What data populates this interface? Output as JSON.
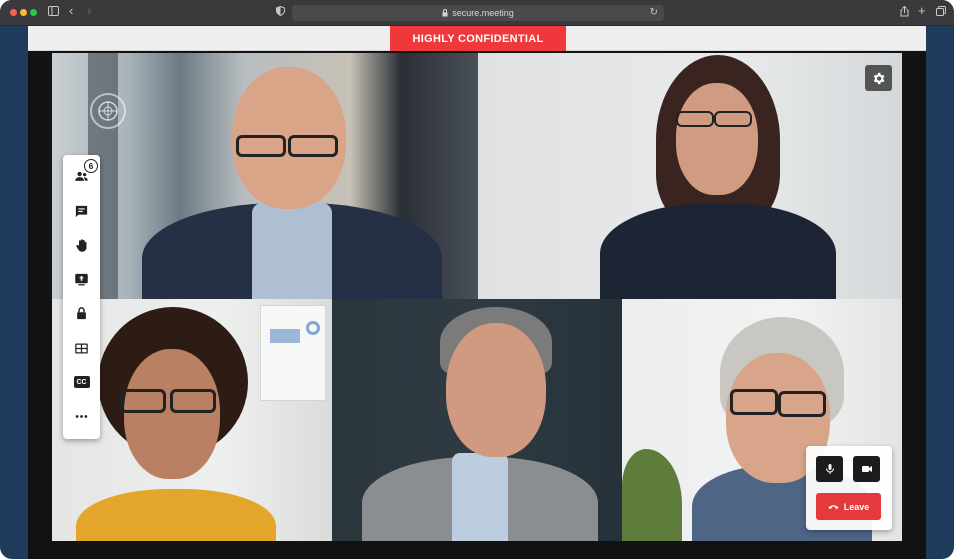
{
  "browser": {
    "address": "secure.meeting",
    "icons": [
      "sidebar-icon",
      "back-icon",
      "forward-icon",
      "shield-icon",
      "lock-icon",
      "reload-icon",
      "share-icon",
      "new-tab-icon",
      "tabs-icon"
    ]
  },
  "meeting": {
    "banner_label": "HIGHLY CONFIDENTIAL",
    "participants_count": "6",
    "sidebar_tools": [
      "participants-icon",
      "chat-icon",
      "raise-hand-icon",
      "share-screen-icon",
      "lock-icon",
      "layout-icon",
      "captions-icon",
      "more-icon"
    ],
    "captions_label": "CC",
    "controls": {
      "leave_label": "Leave"
    }
  },
  "colors": {
    "banner": "#f0383c",
    "leave": "#e5393b",
    "frame": "#1f3b5c"
  }
}
